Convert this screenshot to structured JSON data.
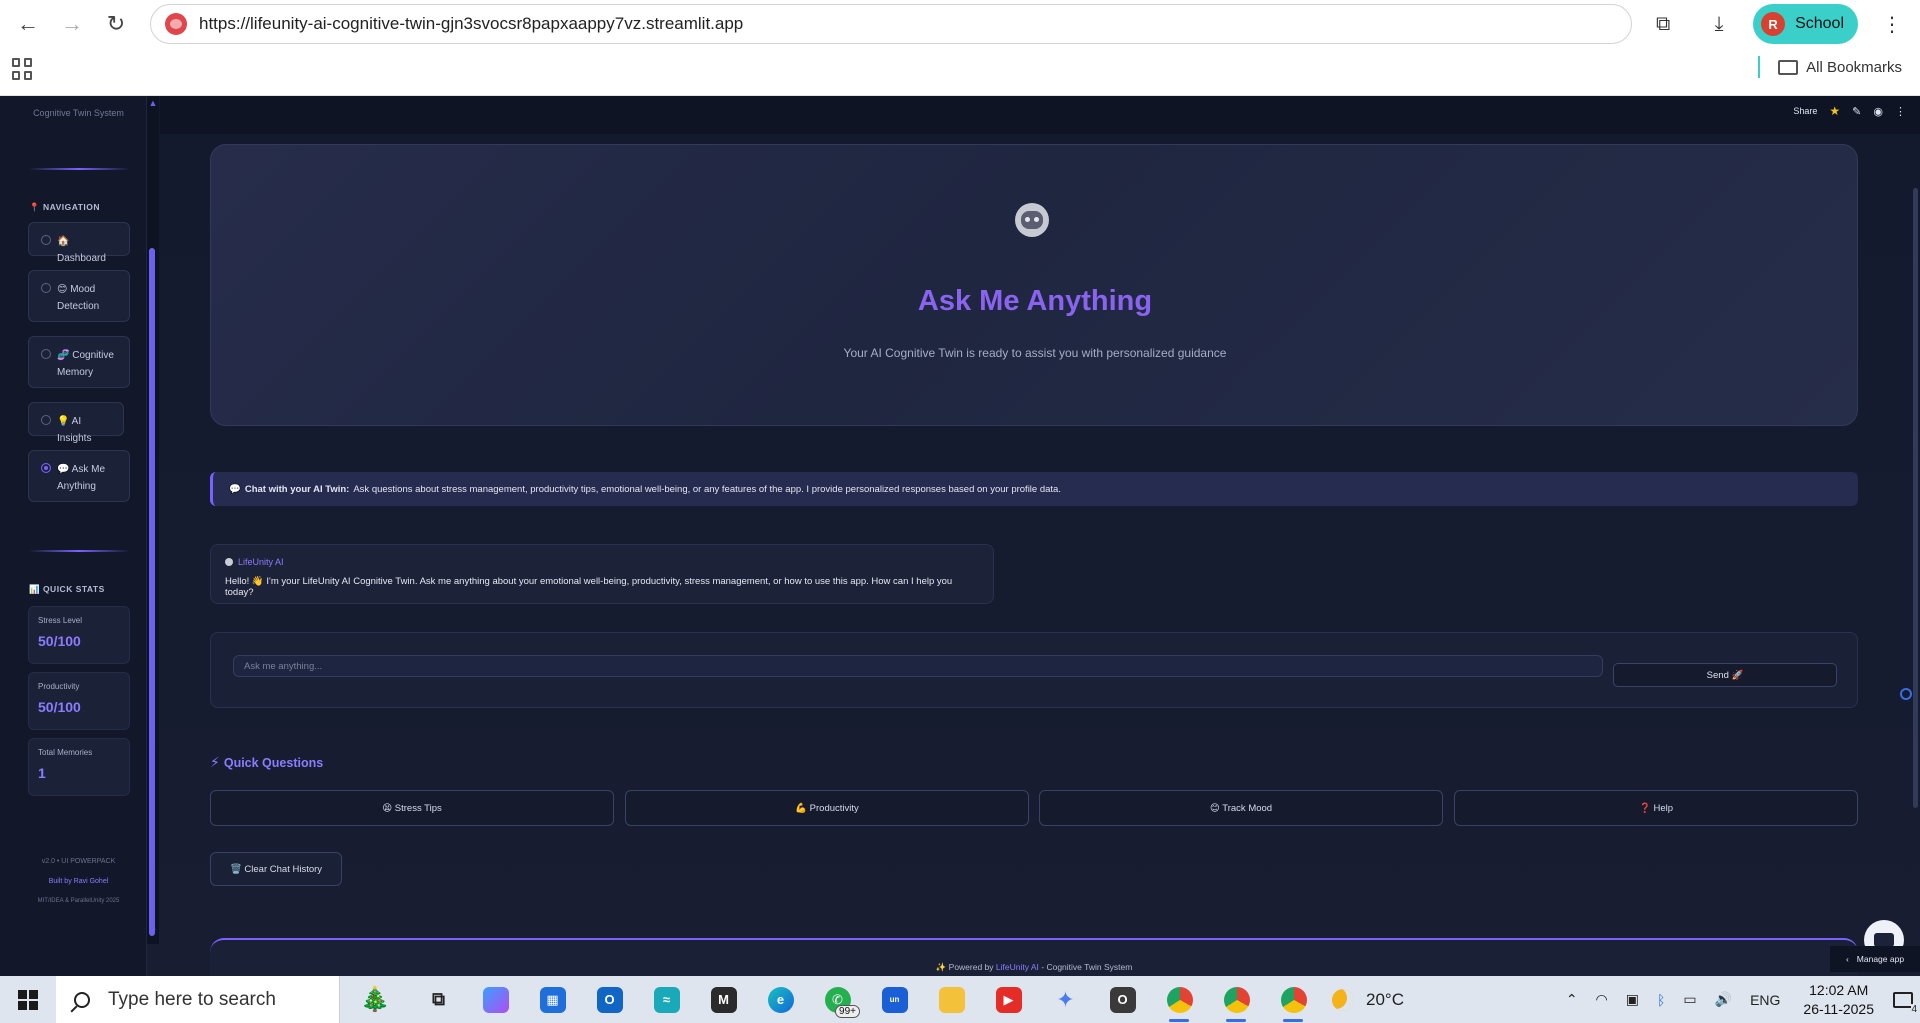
{
  "browser": {
    "url": "https://lifeunity-ai-cognitive-twin-gjn3svocsr8papxaappy7vz.streamlit.app",
    "profile_initial": "R",
    "profile_label": "School",
    "bookmarks_label": "All Bookmarks"
  },
  "sidebar": {
    "caption": "Cognitive Twin System",
    "nav_heading": "📍 NAVIGATION",
    "items": [
      {
        "label": "🏠 Dashboard",
        "active": false
      },
      {
        "label": "😊 Mood Detection",
        "active": false
      },
      {
        "label": "🧬 Cognitive Memory",
        "active": false
      },
      {
        "label": "💡 AI Insights",
        "active": false
      },
      {
        "label": "💬 Ask Me Anything",
        "active": true
      }
    ],
    "stats_heading": "📊 QUICK STATS",
    "stats": [
      {
        "label": "Stress Level",
        "value": "50/100"
      },
      {
        "label": "Productivity",
        "value": "50/100"
      },
      {
        "label": "Total Memories",
        "value": "1"
      }
    ],
    "footer": {
      "version": "v2.0 • UI POWERPACK",
      "built_by": "Built by Ravi Gohel",
      "copyright": "MIT/IDEA & ParallelUnity 2025"
    }
  },
  "topbar": {
    "share": "Share"
  },
  "hero": {
    "title": "Ask Me Anything",
    "subtitle": "Your AI Cognitive Twin is ready to assist you with personalized guidance"
  },
  "info": {
    "icon": "💬",
    "bold": "Chat with your AI Twin:",
    "text": "Ask questions about stress management, productivity tips, emotional well-being, or any features of the app. I provide personalized responses based on your profile data."
  },
  "message": {
    "sender": "LifeUnity AI",
    "text": "Hello! 👋 I'm your LifeUnity AI Cognitive Twin. Ask me anything about your emotional well-being, productivity, stress management, or how to use this app. How can I help you today?"
  },
  "chat_input": {
    "placeholder": "Ask me anything...",
    "value": ""
  },
  "send_label": "Send 🚀",
  "quick_questions": {
    "title": "Quick Questions",
    "buttons": [
      "😫 Stress Tips",
      "💪 Productivity",
      "😊 Track Mood",
      "❓ Help"
    ]
  },
  "clear_label": "🗑️ Clear Chat History",
  "footer": {
    "prefix": "✨ Powered by ",
    "brand": "LifeUnity AI",
    "suffix": " - Cognitive Twin System"
  },
  "manage_app": "Manage app",
  "taskbar": {
    "search_placeholder": "Type here to search",
    "badge_count": "99+",
    "temperature": "20°C",
    "language": "ENG",
    "time": "12:02 AM",
    "date": "26-11-2025",
    "notification_count": "4"
  },
  "colors": {
    "accent": "#8a63f0",
    "background": "#141a2e"
  }
}
